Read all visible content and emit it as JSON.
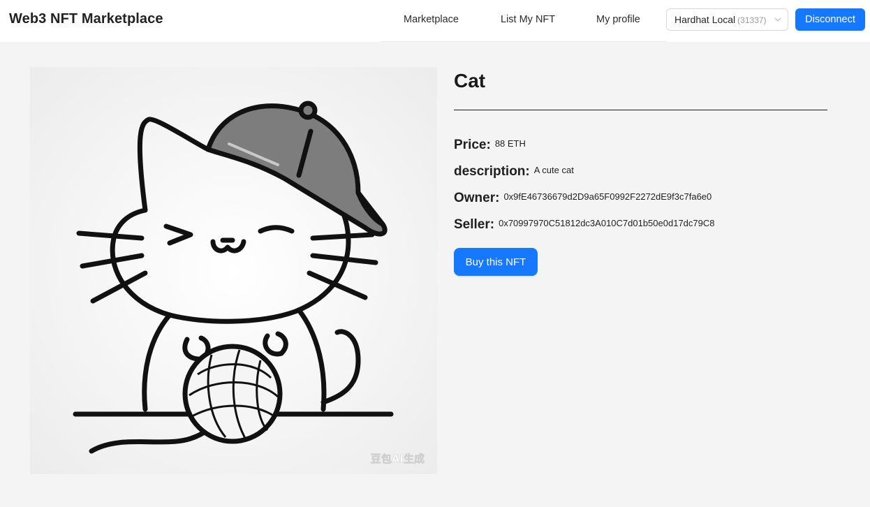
{
  "header": {
    "brand": "Web3 NFT Marketplace",
    "nav": [
      "Marketplace",
      "List My NFT",
      "My profile"
    ],
    "network": {
      "name": "Hardhat Local",
      "chain_id": "(31337)"
    },
    "disconnect_label": "Disconnect"
  },
  "nft": {
    "title": "Cat",
    "image_watermark": "豆包AI生成",
    "fields": [
      {
        "label": "Price:",
        "value": "88 ETH"
      },
      {
        "label": "description:",
        "value": "A cute cat"
      },
      {
        "label": "Owner:",
        "value": "0x9fE46736679d2D9a65F0992F2272dE9f3c7fa6e0"
      },
      {
        "label": "Seller:",
        "value": "0x70997970C51812dc3A010C7d01b50e0d17dc79C8"
      }
    ],
    "buy_label": "Buy this NFT"
  },
  "colors": {
    "primary": "#1677ff",
    "background": "#f4f4f4"
  }
}
